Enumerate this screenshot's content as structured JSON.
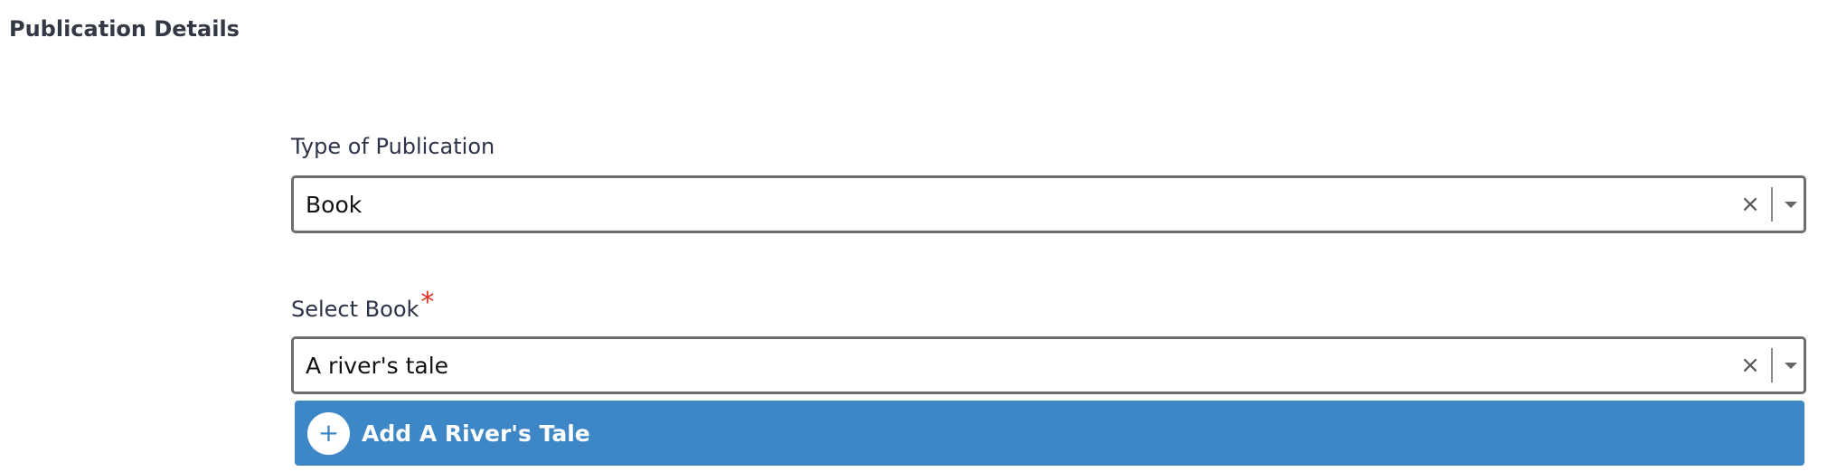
{
  "section": {
    "title": "Publication Details"
  },
  "type_field": {
    "label": "Type of Publication",
    "value": "Book",
    "clear_glyph": "×"
  },
  "book_field": {
    "label": "Select Book",
    "required_mark": "*",
    "value": "A river's tale",
    "clear_glyph": "×"
  },
  "dropdown": {
    "option_label": "Add A River's Tale",
    "option_icon": "plus-icon",
    "plus_glyph": "+",
    "background_color": "#3e87c6"
  },
  "colors": {
    "required": "#e0321f",
    "border": "#6d6d6d"
  }
}
